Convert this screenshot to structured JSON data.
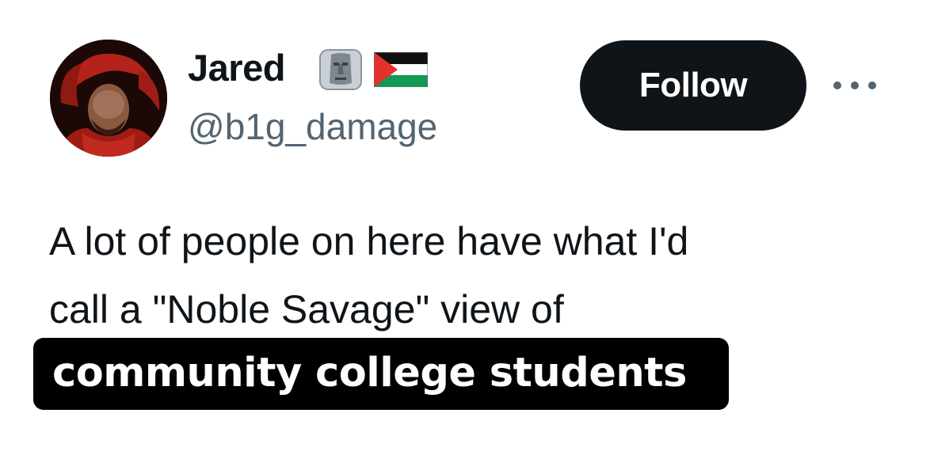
{
  "tweet": {
    "author": {
      "display_name": "Jared",
      "handle": "@b1g_damage",
      "avatar_icon": "avatar-image",
      "badges": [
        {
          "icon": "moai-icon"
        },
        {
          "icon": "palestine-flag-icon"
        }
      ]
    },
    "follow_label": "Follow",
    "more_icon": "more-options-icon",
    "text_lines": [
      "A lot of people on here have what I'd",
      "call a \"Noble Savage\" view of"
    ]
  },
  "caption": {
    "text": "community college students",
    "background": "#000000",
    "color": "#ffffff"
  },
  "colors": {
    "primary_text": "#0f1419",
    "secondary_text": "#536471",
    "follow_bg": "#0f1419",
    "follow_text": "#ffffff"
  }
}
